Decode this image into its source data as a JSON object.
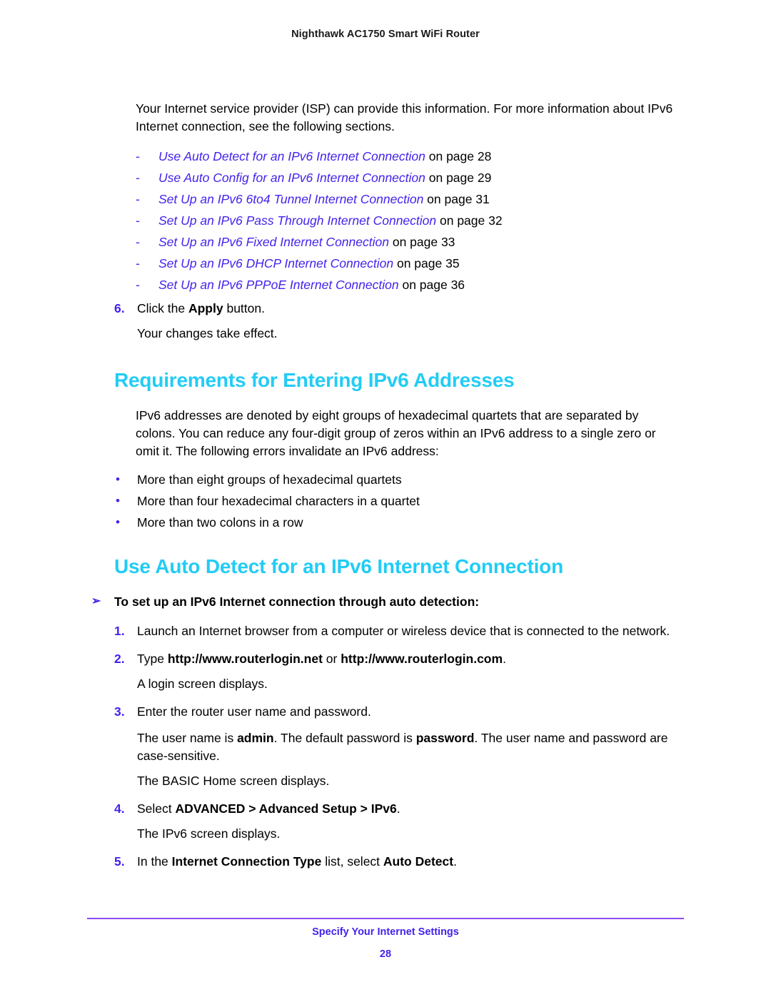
{
  "header": {
    "title": "Nighthawk AC1750 Smart WiFi Router"
  },
  "colors": {
    "heading_cyan": "#22CCF5",
    "link_violet": "#4422EE",
    "rule_purple": "#8A4BF0",
    "body_black": "#000000"
  },
  "intro": {
    "paragraph": "Your Internet service provider (ISP) can provide this information. For more information about IPv6 Internet connection, see the following sections."
  },
  "xref_list": {
    "dash_marker": "-",
    "items": [
      {
        "link": "Use Auto Detect for an IPv6 Internet Connection",
        "page_text": " on page 28"
      },
      {
        "link": "Use Auto Config for an IPv6 Internet Connection",
        "page_text": " on page 29"
      },
      {
        "link": "Set Up an IPv6 6to4 Tunnel Internet Connection",
        "page_text": " on page 31"
      },
      {
        "link": "Set Up an IPv6 Pass Through Internet Connection",
        "page_text": " on page 32"
      },
      {
        "link": "Set Up an IPv6 Fixed Internet Connection",
        "page_text": " on page 33"
      },
      {
        "link": "Set Up an IPv6 DHCP Internet Connection",
        "page_text": " on page 35"
      },
      {
        "link": "Set Up an IPv6 PPPoE Internet Connection",
        "page_text": " on page 36"
      }
    ]
  },
  "step6": {
    "number": "6.",
    "text_before": "Click the ",
    "bold": "Apply",
    "text_after": " button.",
    "result": "Your changes take effect."
  },
  "section_requirements": {
    "heading": "Requirements for Entering IPv6 Addresses",
    "paragraph": "IPv6 addresses are denoted by eight groups of hexadecimal quartets that are separated by colons. You can reduce any four-digit group of zeros within an IPv6 address to a single zero or omit it. The following errors invalidate an IPv6 address:",
    "bullet_marker": "•",
    "bullets": [
      "More than eight groups of hexadecimal quartets",
      "More than four hexadecimal characters in a quartet",
      "More than two colons in a row"
    ]
  },
  "section_autodetect": {
    "heading": "Use Auto Detect for an IPv6 Internet Connection",
    "arrow_marker": "➢",
    "procedure_lead": "To set up an IPv6 Internet connection through auto detection:",
    "steps": {
      "s1": {
        "number": "1.",
        "text": "Launch an Internet browser from a computer or wireless device that is connected to the network."
      },
      "s2": {
        "number": "2.",
        "text_before": "Type ",
        "bold1": "http://www.routerlogin.net",
        "text_middle": " or ",
        "bold2": "http://www.routerlogin.com",
        "text_after": ".",
        "result": "A login screen displays."
      },
      "s3": {
        "number": "3.",
        "text": "Enter the router user name and password.",
        "result_before": "The user name is ",
        "result_bold1": "admin",
        "result_middle": ". The default password is ",
        "result_bold2": "password",
        "result_after": ". The user name and password are case-sensitive.",
        "result2": "The BASIC Home screen displays."
      },
      "s4": {
        "number": "4.",
        "text_before": "Select ",
        "bold": "ADVANCED > Advanced Setup > IPv6",
        "text_after": ".",
        "result": "The IPv6 screen displays."
      },
      "s5": {
        "number": "5.",
        "text_before": "In the ",
        "bold1": "Internet Connection Type",
        "text_middle": " list, select ",
        "bold2": "Auto Detect",
        "text_after": "."
      }
    }
  },
  "footer": {
    "title": "Specify Your Internet Settings",
    "page_number": "28"
  }
}
